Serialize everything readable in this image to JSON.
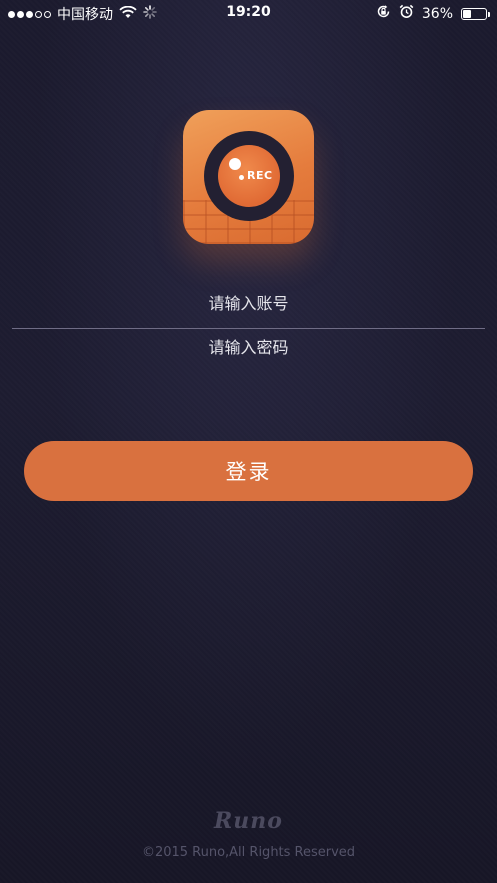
{
  "status_bar": {
    "carrier": "中国移动",
    "time": "19:20",
    "battery_text": "36%",
    "battery_level": 0.36,
    "signal_bars": 3,
    "signal_total": 5
  },
  "app_icon": {
    "badge_text": "REC",
    "colors": {
      "primary": "#e57c3d",
      "ring": "#232032"
    }
  },
  "login": {
    "account_placeholder": "请输入账号",
    "password_placeholder": "请输入密码",
    "button_label": "登录"
  },
  "footer": {
    "brand": "Runo",
    "copyright": "©2015 Runo,All Rights Reserved"
  },
  "colors": {
    "background": "#1b1a2e",
    "accent": "#d9713f"
  }
}
